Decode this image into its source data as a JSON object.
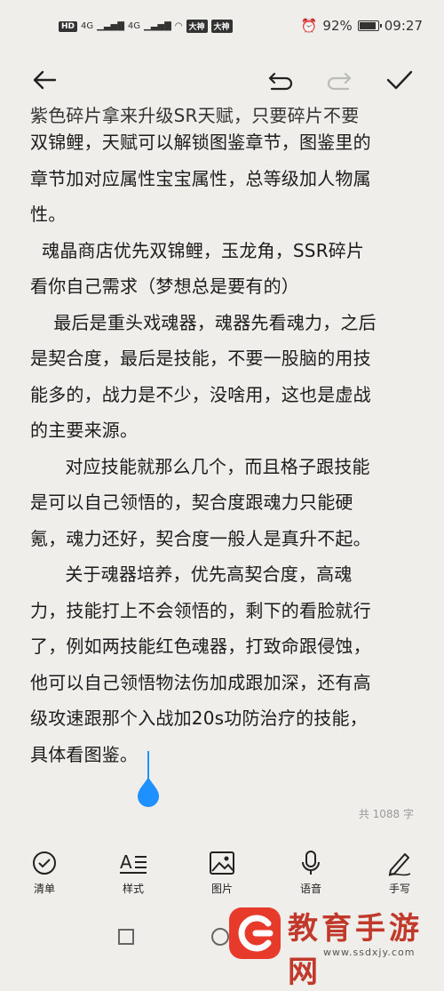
{
  "status_bar": {
    "hd": "HD",
    "net1": "4G",
    "net2": "4G",
    "app_badge_1": "大神",
    "app_badge_2": "大神",
    "battery": "92%",
    "time": "09:27"
  },
  "toolbar": {
    "back": "back-arrow-icon",
    "undo": "undo-icon",
    "redo": "redo-icon",
    "done": "check-icon"
  },
  "content": {
    "cut_line": "紫色碎片拿来升级SR天赋，只要碎片不要",
    "paragraphs": [
      "双锦鲤，天赋可以解锁图鉴章节，图鉴里的章节加对应属性宝宝属性，总等级加人物属性。",
      "魂晶商店优先双锦鲤，玉龙角，SSR碎片看你自己需求（梦想总是要有的）",
      "最后是重头戏魂器，魂器先看魂力，之后是契合度，最后是技能，不要一股脑的用技能多的，战力是不少，没啥用，这也是虚战的主要来源。",
      "对应技能就那么几个，而且格子跟技能是可以自己领悟的，契合度跟魂力只能硬氪，魂力还好，契合度一般人是真升不起。",
      "关于魂器培养，优先高契合度，高魂力，技能打上不会领悟的，剩下的看脸就行了，例如两技能红色魂器，打致命跟侵蚀，他可以自己领悟物法伤加成跟加深，还有高级攻速跟那个入战加20s功防治疗的技能，具体看图鉴。"
    ],
    "lines": [
      "双锦鲤，天赋可以解锁图鉴章节，图鉴里的",
      "章节加对应属性宝宝属性，总等级加人物属",
      "性。",
      "  魂晶商店优先双锦鲤，玉龙角，SSR碎片",
      "看你自己需求（梦想总是要有的）",
      "    最后是重头戏魂器，魂器先看魂力，之后",
      "是契合度，最后是技能，不要一股脑的用技",
      "能多的，战力是不少，没啥用，这也是虚战",
      "的主要来源。",
      "      对应技能就那么几个，而且格子跟技能",
      "是可以自己领悟的，契合度跟魂力只能硬",
      "氪，魂力还好，契合度一般人是真升不起。",
      "      关于魂器培养，优先高契合度，高魂",
      "力，技能打上不会领悟的，剩下的看脸就行",
      "了，例如两技能红色魂器，打致命跟侵蚀，",
      "他可以自己领悟物法伤加成跟加深，还有高",
      "级攻速跟那个入战加20s功防治疗的技能，",
      "具体看图鉴。"
    ]
  },
  "word_count": "共 1088 字",
  "bottom_bar": {
    "checklist": "清单",
    "style": "样式",
    "image": "图片",
    "voice": "语音",
    "handwrite": "手写"
  },
  "watermark": {
    "text": "教育手游网",
    "url": "www.ssdxjy.com"
  },
  "colors": {
    "background": "#efeeea",
    "cursor": "#1e90ff",
    "watermark_red": "#e83a2b"
  }
}
